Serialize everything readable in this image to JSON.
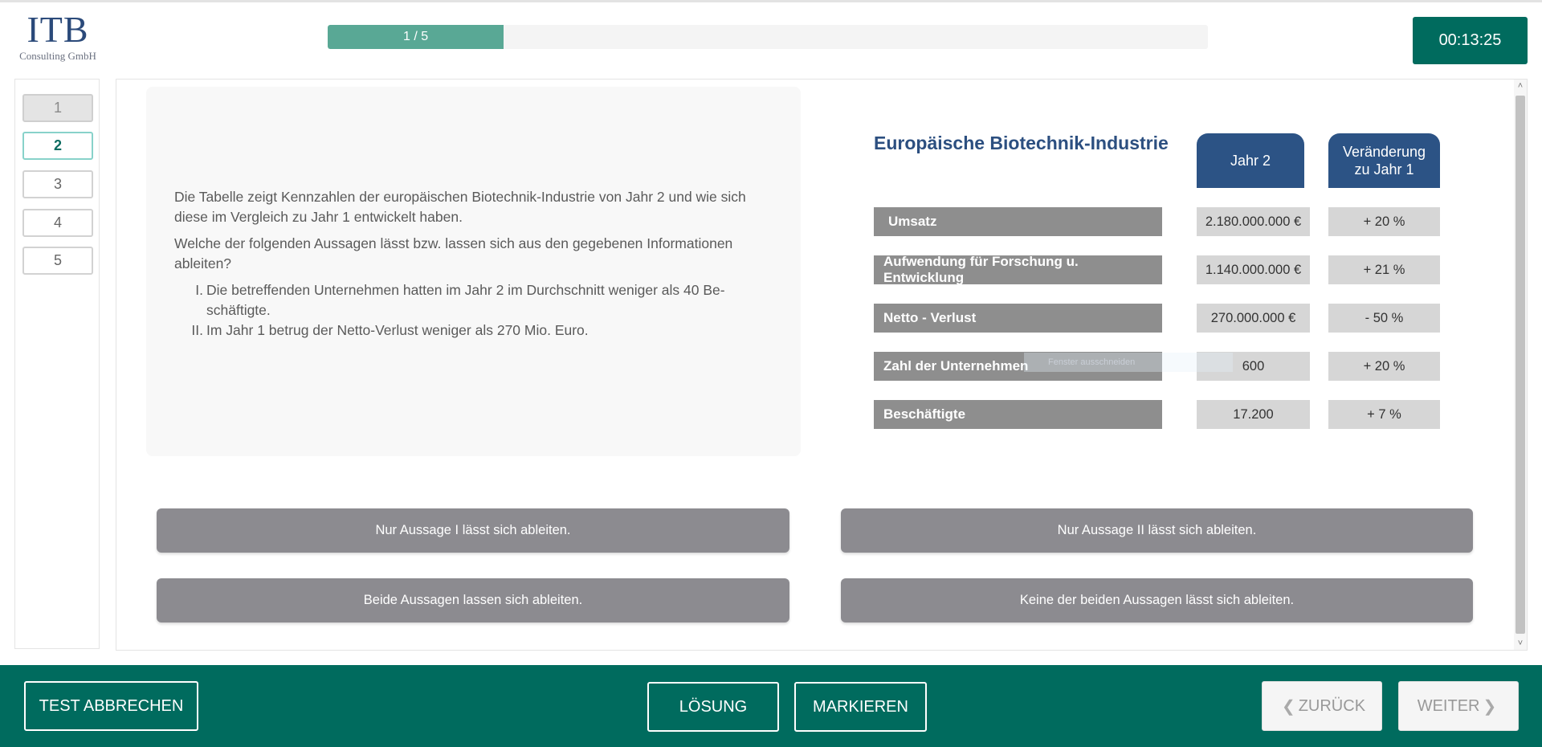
{
  "logo": {
    "main": "ITB",
    "sub": "Consulting GmbH"
  },
  "progress": {
    "label": "1 / 5",
    "current": 1,
    "total": 5,
    "fill_fraction": 0.2
  },
  "timer": "00:13:25",
  "question_nav": [
    "1",
    "2",
    "3",
    "4",
    "5"
  ],
  "question": {
    "intro": "Die Tabelle zeigt Kennzahlen der europäischen Biotechnik-Industrie von Jahr 2 und wie sich diese im Vergleich zu Jahr 1 entwickelt haben.",
    "prompt": "Welche der folgenden Aussagen lässt bzw. lassen sich aus den gegebenen Informationen ableiten?",
    "statements": [
      {
        "num": "I.",
        "text": "Die betreffenden Unternehmen hatten im Jahr 2 im Durchschnitt weniger als 40 Be-schäftigte."
      },
      {
        "num": "II.",
        "text": "Im Jahr 1 betrug der Netto-Verlust weniger als 270 Mio. Euro."
      }
    ]
  },
  "table": {
    "title": "Europäische Biotechnik-Industrie",
    "col1": "Jahr 2",
    "col2_line1": "Veränderung",
    "col2_line2": "zu Jahr 1",
    "rows": [
      {
        "label": "Umsatz",
        "value": "2.180.000.000 €",
        "change": "+  20 %"
      },
      {
        "label": "Aufwendung für Forschung u. Entwicklung",
        "value": "1.140.000.000 €",
        "change": "+ 21 %"
      },
      {
        "label": "Netto - Verlust",
        "value": "270.000.000 €",
        "change": "- 50 %"
      },
      {
        "label": "Zahl der Unternehmen",
        "value": "600",
        "change": "+ 20 %"
      },
      {
        "label": "Beschäftigte",
        "value": "17.200",
        "change": "+ 7 %"
      }
    ]
  },
  "overlay_tip": "Fenster ausschneiden",
  "answers": [
    "Nur Aussage I lässt sich ableiten.",
    "Nur Aussage II lässt sich ableiten.",
    "Beide Aussagen lassen sich ableiten.",
    "Keine der beiden Aussagen lässt sich ableiten."
  ],
  "footer": {
    "cancel": "TEST ABBRECHEN",
    "solution": "LÖSUNG",
    "mark": "MARKIEREN",
    "back": "ZURÜCK",
    "next": "WEITER"
  },
  "icons": {
    "back": "chevron-left-icon",
    "next": "chevron-right-icon",
    "scroll_up": "arrow-up-icon",
    "scroll_down": "arrow-down-icon"
  },
  "colors": {
    "brand": "#006b5e",
    "progress": "#59a895",
    "table_header": "#2c5385",
    "answer": "#8c8b90"
  }
}
